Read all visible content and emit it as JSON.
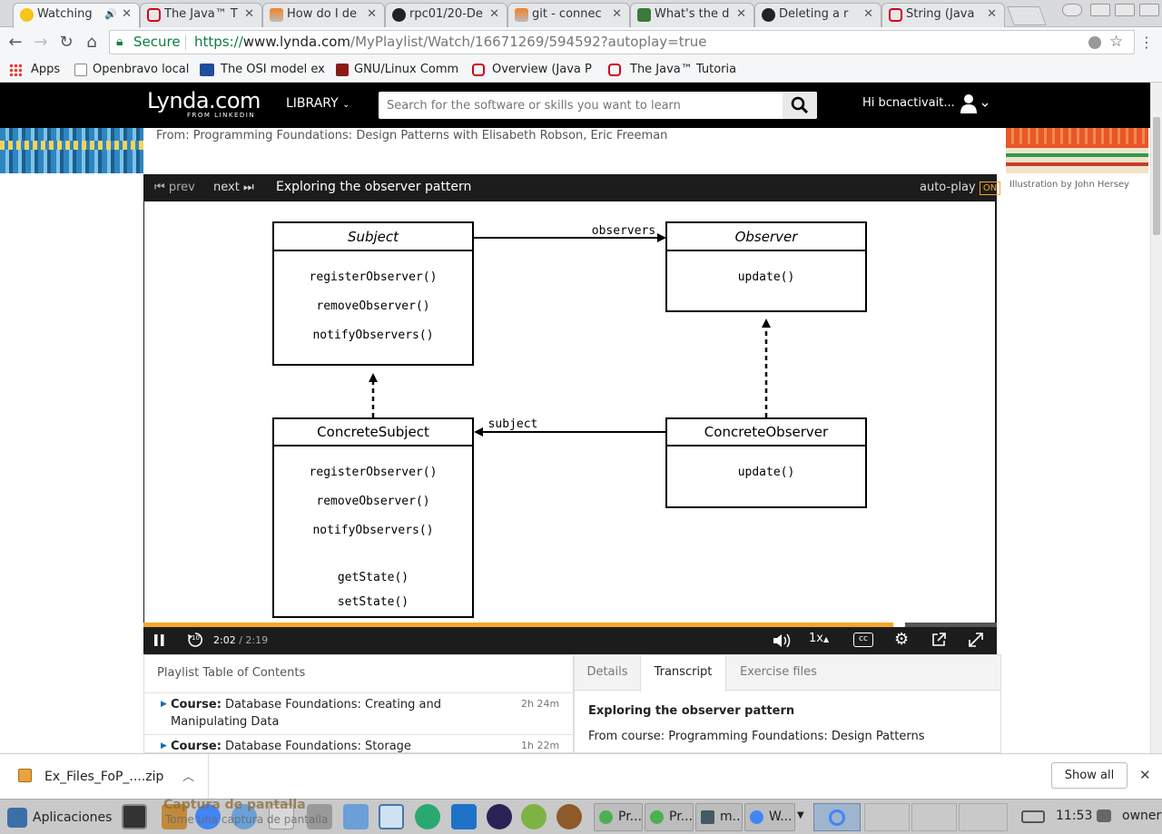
{
  "browser": {
    "tabs": [
      {
        "title": "Watching",
        "audio": "🔊",
        "favicon_color": "#f5c518"
      },
      {
        "title": "The Java™ T",
        "favicon_color": "#d0021b"
      },
      {
        "title": "How do I de",
        "favicon_color": "#f48024"
      },
      {
        "title": "rpc01/20-De",
        "favicon_color": "#222222"
      },
      {
        "title": "git - connec",
        "favicon_color": "#f48024"
      },
      {
        "title": "What's the d",
        "favicon_color": "#3b7a3b"
      },
      {
        "title": "Deleting a r",
        "favicon_color": "#222222"
      },
      {
        "title": "String (Java",
        "favicon_color": "#d0021b"
      }
    ],
    "close_glyph": "✕",
    "secure_label": "Secure",
    "url_scheme": "https://",
    "url_host": "www.lynda.com",
    "url_path": "/MyPlaylist/Watch/16671269/594592?autoplay=true",
    "bookmarks": [
      {
        "label": "Apps",
        "favicon_color": "#e53935"
      },
      {
        "label": "Openbravo local",
        "favicon_color": "#ffffff"
      },
      {
        "label": "The OSI model ex",
        "favicon_color": "#1f4e9c"
      },
      {
        "label": "GNU/Linux Comm",
        "favicon_color": "#8b1a1a"
      },
      {
        "label": "Overview (Java P",
        "favicon_color": "#d0021b"
      },
      {
        "label": "The Java™ Tutoria",
        "favicon_color": "#d0021b"
      }
    ]
  },
  "site": {
    "logo_main": "Lynda.com",
    "logo_sub": "FROM LINKEDIN",
    "library_label": "LIBRARY",
    "search_placeholder": "Search for the software or skills you want to learn",
    "greeting": "Hi bcnactivait...",
    "course_from": "From: Programming Foundations: Design Patterns with Elisabeth Robson, Eric Freeman",
    "illustration_credit": "Illustration by John Hersey"
  },
  "player": {
    "prev_label": "prev",
    "next_label": "next",
    "video_title": "Exploring the observer pattern",
    "autoplay_label": "auto-play",
    "autoplay_state": "ON",
    "current_time": "2:02",
    "separator": "/",
    "duration": "2:19",
    "progress_fraction": 0.885,
    "speed_label": "1x",
    "cc_label": "cc",
    "skip_back_label": "10"
  },
  "diagram": {
    "subject": {
      "title": "Subject",
      "methods": [
        "registerObserver()",
        "removeObserver()",
        "notifyObservers()"
      ]
    },
    "observer": {
      "title": "Observer",
      "methods": [
        "update()"
      ]
    },
    "concrete_subject": {
      "title": "ConcreteSubject",
      "methods": [
        "registerObserver()",
        "removeObserver()",
        "notifyObservers()",
        "getState()",
        "setState()"
      ]
    },
    "concrete_observer": {
      "title": "ConcreteObserver",
      "methods": [
        "update()"
      ]
    },
    "assoc_observers": "observers",
    "assoc_subject": "subject"
  },
  "toc": {
    "title": "Playlist Table of Contents",
    "items": [
      {
        "prefix": "Course:",
        "name": "Database Foundations: Creating and",
        "name2": "Manipulating Data",
        "duration": "2h 24m"
      },
      {
        "prefix": "Course:",
        "name": "Database Foundations: Storage",
        "duration": "1h 22m"
      }
    ]
  },
  "detail_tabs": {
    "tabs": [
      "Details",
      "Transcript",
      "Exercise files"
    ],
    "active": "Transcript",
    "heading": "Exploring the observer pattern",
    "from_course": "From course: Programming Foundations: Design Patterns"
  },
  "downloads": {
    "file": "Ex_Files_FoP_....zip",
    "show_all": "Show all"
  },
  "taskbar": {
    "apps_label": "Aplicaciones",
    "windows": [
      {
        "label": "Pr...",
        "color": "#4caf50"
      },
      {
        "label": "Pr...",
        "color": "#4caf50"
      },
      {
        "label": "m...",
        "color": "#455a64"
      },
      {
        "label": "W...",
        "color": "#4285f4"
      }
    ],
    "clock": "11:53",
    "user": "owner",
    "ghost_title": "Captura de pantalla",
    "ghost_sub": "Tome una captura de pantalla"
  }
}
